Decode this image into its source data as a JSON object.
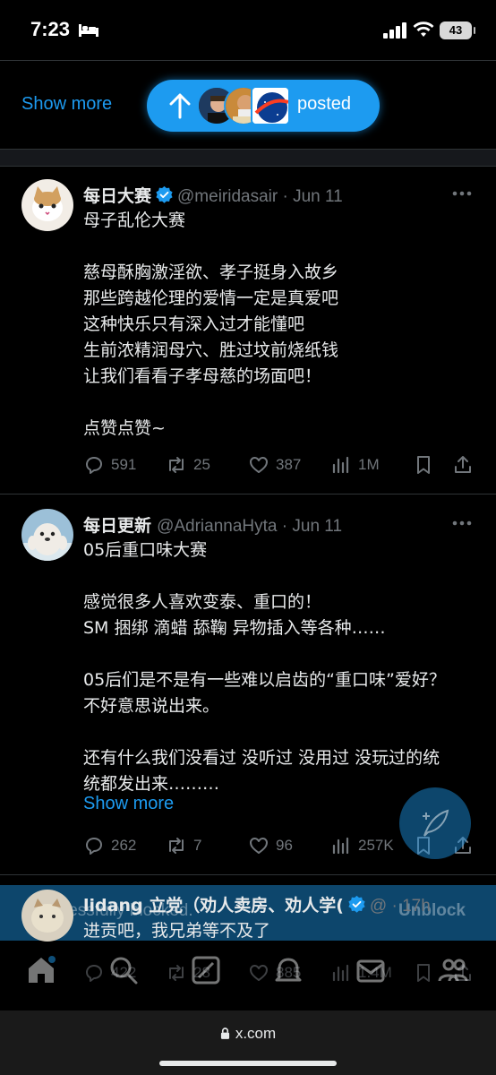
{
  "status_bar": {
    "time": "7:23",
    "battery": "43"
  },
  "top": {
    "show_more": "Show more",
    "posted_label": "posted"
  },
  "tweets": [
    {
      "name": "每日大赛",
      "handle": "@meiridasair",
      "date": "Jun 11",
      "text": "母子乱伦大赛\n\n慈母酥胸激淫欲、孝子挺身入故乡\n那些跨越伦理的爱情一定是真爱吧\n这种快乐只有深入过才能懂吧\n生前浓精润母穴、胜过坟前烧纸钱\n让我们看看子孝母慈的场面吧！\n\n点赞点赞~",
      "replies": "591",
      "reposts": "25",
      "likes": "387",
      "views": "1M"
    },
    {
      "name": "每日更新",
      "handle": "@AdriannaHyta",
      "date": "Jun 11",
      "text": "05后重口味大赛\n\n感觉很多人喜欢变泰、重口的！\nSM 捆绑 滴蜡 舔鞠 异物插入等各种……\n\n05后们是不是有一些难以启齿的“重口味”爱好？\n不好意思说出来。\n\n还有什么我们没看过 没听过 没用过 没玩过的统\n统都发出来………",
      "show_more": "Show more",
      "replies": "262",
      "reposts": "7",
      "likes": "96",
      "views": "257K"
    },
    {
      "name": "lidang 立党（劝人卖房、劝人学(",
      "handle": "@",
      "date": "17h",
      "text": "进贡吧，我兄弟等不及了",
      "replies": "422",
      "reposts": "28",
      "likes": "885",
      "views": "1.4M"
    }
  ],
  "toast": {
    "text": "Successfully blocked.",
    "action": "Unblock"
  },
  "url_bar": {
    "url": "x.com"
  },
  "colors": {
    "accent": "#1d9bf0",
    "background": "#000000",
    "muted": "#71767b"
  }
}
